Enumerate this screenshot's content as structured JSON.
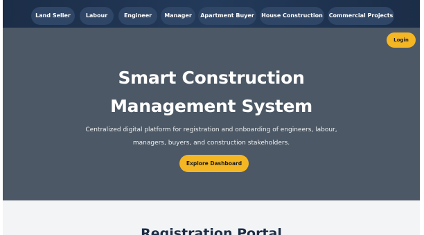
{
  "nav": {
    "items": [
      {
        "label": "Land Seller"
      },
      {
        "label": "Labour"
      },
      {
        "label": "Engineer"
      },
      {
        "label": "Manager"
      },
      {
        "label": "Apartment Buyer"
      },
      {
        "label": "House Construction"
      },
      {
        "label": "Commercial Projects"
      }
    ]
  },
  "header": {
    "login_label": "Login"
  },
  "hero": {
    "title_line1": "Smart Construction",
    "title_line2": "Management System",
    "subtitle_line1": "Centralized digital platform for registration and onboarding of engineers, labour,",
    "subtitle_line2": "managers, buyers, and construction stakeholders.",
    "cta_label": "Explore Dashboard"
  },
  "registration": {
    "title": "Registration Portal"
  },
  "colors": {
    "nav_bg": "#1b2d47",
    "nav_pill": "#2f4667",
    "hero_bg": "#4c5865",
    "accent": "#f5b623",
    "section_bg": "#f3f4f6"
  }
}
